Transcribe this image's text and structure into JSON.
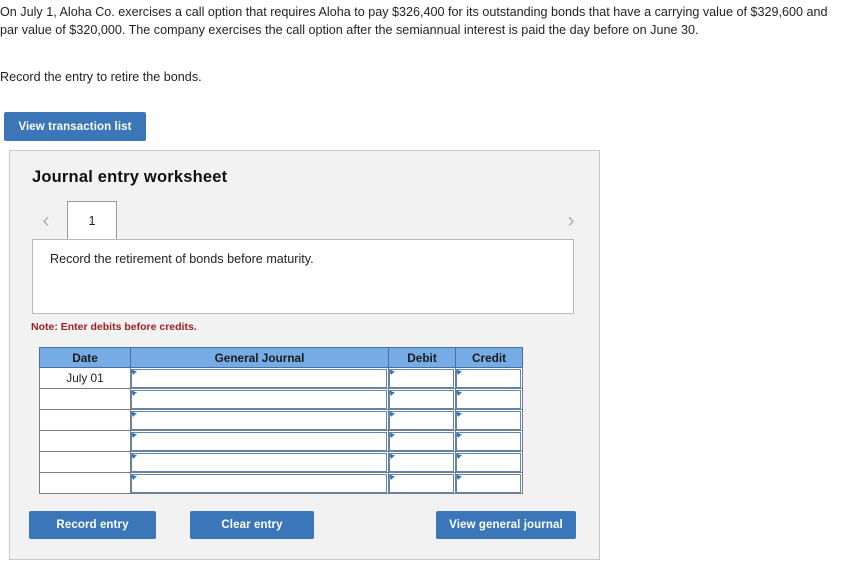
{
  "problem": {
    "text": "On July 1, Aloha Co. exercises a call option that requires Aloha to pay $326,400 for its outstanding bonds that have a carrying value of $329,600 and par value of $320,000. The company exercises the call option after the semiannual interest is paid the day before on June 30.",
    "instruction": "Record the entry to retire the bonds."
  },
  "toolbar": {
    "view_transaction_list_label": "View transaction list"
  },
  "worksheet": {
    "title": "Journal entry worksheet",
    "prev_arrow": "‹",
    "next_arrow": "›",
    "tabs": [
      {
        "label": "1",
        "active": true
      }
    ],
    "description": "Record the retirement of bonds before maturity.",
    "note": "Note: Enter debits before credits."
  },
  "table": {
    "headers": [
      "Date",
      "General Journal",
      "Debit",
      "Credit"
    ],
    "rows": [
      {
        "date": "July 01",
        "general_journal": "",
        "debit": "",
        "credit": ""
      },
      {
        "date": "",
        "general_journal": "",
        "debit": "",
        "credit": ""
      },
      {
        "date": "",
        "general_journal": "",
        "debit": "",
        "credit": ""
      },
      {
        "date": "",
        "general_journal": "",
        "debit": "",
        "credit": ""
      },
      {
        "date": "",
        "general_journal": "",
        "debit": "",
        "credit": ""
      },
      {
        "date": "",
        "general_journal": "",
        "debit": "",
        "credit": ""
      }
    ]
  },
  "footer": {
    "record_entry_label": "Record entry",
    "clear_entry_label": "Clear entry",
    "view_general_journal_label": "View general journal"
  },
  "colors": {
    "button_blue": "#3a76b8",
    "header_blue": "#76ace6",
    "note_red": "#9b2020",
    "panel_gray": "#f2f2f2"
  }
}
